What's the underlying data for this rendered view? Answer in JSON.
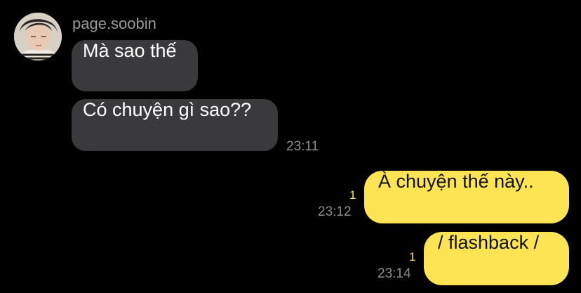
{
  "chat": {
    "incoming": {
      "sender": "page.soobin",
      "messages": [
        {
          "text": "Mà sao thế"
        },
        {
          "text": "Có chuyện gì sao??",
          "time": "23:11"
        }
      ]
    },
    "outgoing": [
      {
        "text": "À chuyện thế này..",
        "time": "23:12",
        "unread": "1"
      },
      {
        "text": "/ flashback /",
        "time": "23:14",
        "unread": "1"
      }
    ]
  },
  "colors": {
    "background": "#000000",
    "incoming_bubble": "#3a3a3c",
    "outgoing_bubble": "#fde454",
    "timestamp": "#8e8e8e",
    "unread_count": "#fde454"
  },
  "icons": {
    "avatar": "profile-photo"
  }
}
